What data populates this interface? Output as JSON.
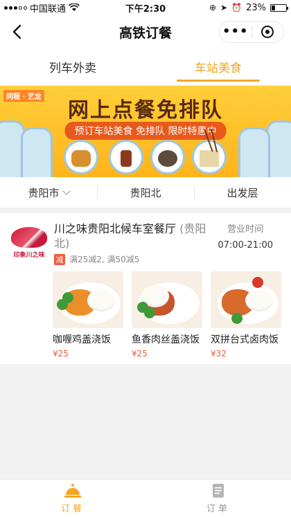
{
  "status_bar": {
    "carrier": "中国联通",
    "time": "下午2:30",
    "battery": "23%",
    "battery_level": 0.23
  },
  "nav": {
    "title": "高铁订餐"
  },
  "tabs": [
    {
      "label": "列车外卖",
      "active": false
    },
    {
      "label": "车站美食",
      "active": true
    }
  ],
  "banner": {
    "brand": "同程 · 艺龙",
    "headline": "网上点餐免排队",
    "subline": "预订车站美食 免排队 限时特惠中"
  },
  "filters": [
    {
      "label": "贵阳市",
      "dropdown": true
    },
    {
      "label": "贵阳北",
      "dropdown": false
    },
    {
      "label": "出发层",
      "dropdown": false
    }
  ],
  "restaurant": {
    "name": "川之味贵阳北候车室餐厅",
    "region": "(贵阳北)",
    "logo_text": "印象川之味",
    "hours_label": "营业时间",
    "hours": "07:00-21:00",
    "promo_badge": "减",
    "promo_text": "满25减2, 满50减5",
    "dishes": [
      {
        "name": "咖喱鸡盖浇饭",
        "price": "¥25",
        "topping_color": "#e9902a"
      },
      {
        "name": "鱼香肉丝盖浇饭",
        "price": "¥25",
        "topping_color": "#c8552a"
      },
      {
        "name": "双拼台式卤肉饭",
        "price": "¥32",
        "topping_color": "#d86a2c"
      }
    ]
  },
  "tabbar": [
    {
      "label": "订餐",
      "active": true
    },
    {
      "label": "订单",
      "active": false
    }
  ],
  "colors": {
    "accent": "#f5a623",
    "price": "#e95b3a",
    "promo": "#f25b3a"
  }
}
